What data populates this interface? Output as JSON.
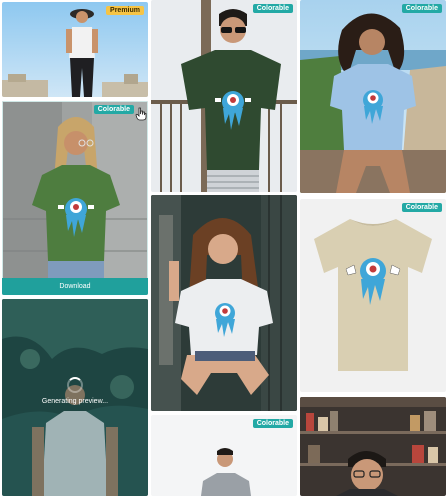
{
  "badges": {
    "premium": "Premium",
    "colorable": "Colorable"
  },
  "cards": {
    "hat_model": {
      "badge": "Premium"
    },
    "curly_model": {
      "badge": "Colorable"
    },
    "green_model": {
      "badge": "Colorable",
      "action": "Download"
    },
    "tan_shirt": {
      "badge": "Colorable"
    },
    "bottom_man": {
      "badge": "Colorable"
    },
    "generating": {
      "status": "Generating preview..."
    }
  },
  "colors": {
    "accent": "#20a09c",
    "premium": "#f6c445",
    "shirt_green": "#4e7d3f",
    "shirt_dark_green": "#2f4a30",
    "shirt_blue": "#9ec3e6",
    "shirt_tan": "#d9cfb2",
    "shirt_white": "#eceef0"
  },
  "icons": {
    "cursor": "hand-pointer-icon",
    "spinner": "loading-spinner-icon",
    "graphic": "eyeball-monster-graphic"
  }
}
